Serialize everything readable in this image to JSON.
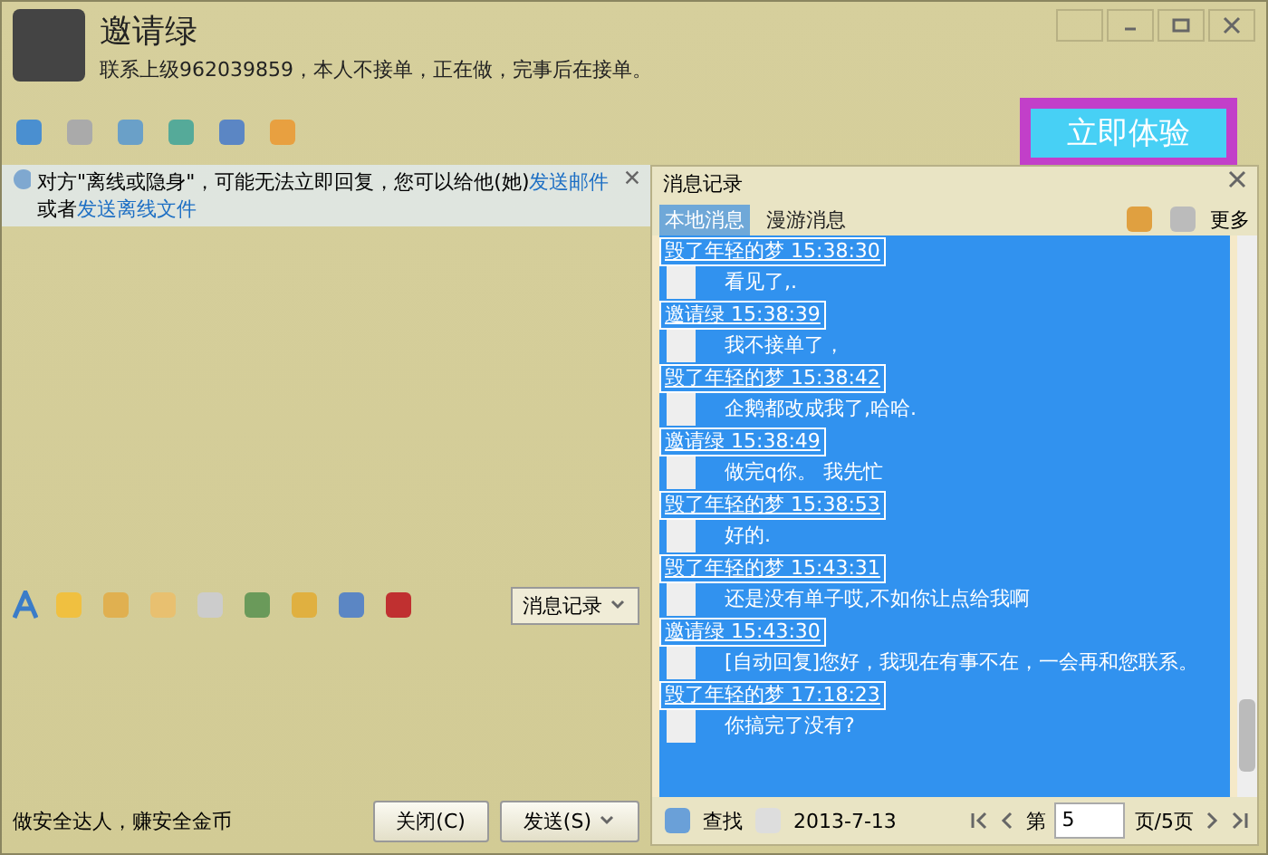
{
  "contact": {
    "name": "邀请绿",
    "signature": "联系上级962039859，本人不接单，正在做，完事后在接单。"
  },
  "promo_button": "立即体验",
  "notice": {
    "text": "对方\"离线或隐身\"，可能无法立即回复，您可以给他(她)",
    "link1": "发送邮件",
    "middle": "或者",
    "link2": "发送离线文件"
  },
  "history": {
    "title": "消息记录",
    "tabs": [
      {
        "label": "本地消息",
        "selected": true
      },
      {
        "label": "漫游消息",
        "selected": false
      }
    ],
    "more": "更多",
    "messages": [
      {
        "kind": "header",
        "text": "毁了年轻的梦 15:38:30"
      },
      {
        "kind": "body",
        "text": "看见了,."
      },
      {
        "kind": "header",
        "text": "邀请绿 15:38:39"
      },
      {
        "kind": "body",
        "text": "我不接单了，"
      },
      {
        "kind": "header",
        "text": "毁了年轻的梦 15:38:42"
      },
      {
        "kind": "body",
        "text": "企鹅都改成我了,哈哈."
      },
      {
        "kind": "header",
        "text": "邀请绿 15:38:49"
      },
      {
        "kind": "body",
        "text": "做完q你。  我先忙"
      },
      {
        "kind": "header",
        "text": "毁了年轻的梦 15:38:53"
      },
      {
        "kind": "body",
        "text": "好的."
      },
      {
        "kind": "header",
        "text": "毁了年轻的梦 15:43:31"
      },
      {
        "kind": "body",
        "text": "还是没有单子哎,不如你让点给我啊"
      },
      {
        "kind": "header",
        "text": "邀请绿 15:43:30"
      },
      {
        "kind": "body",
        "text": "[自动回复]您好，我现在有事不在，一会再和您联系。"
      },
      {
        "kind": "header",
        "text": "毁了年轻的梦 17:18:23"
      },
      {
        "kind": "body",
        "text": "你搞完了没有?"
      }
    ],
    "find": "查找",
    "date": "2013-7-13",
    "page_prefix": "第",
    "page": "5",
    "page_suffix": "页/5页"
  },
  "history_button": "消息记录",
  "footer": {
    "tip": "做安全达人，赚安全金币",
    "close": "关闭(C)",
    "send": "发送(S)"
  }
}
